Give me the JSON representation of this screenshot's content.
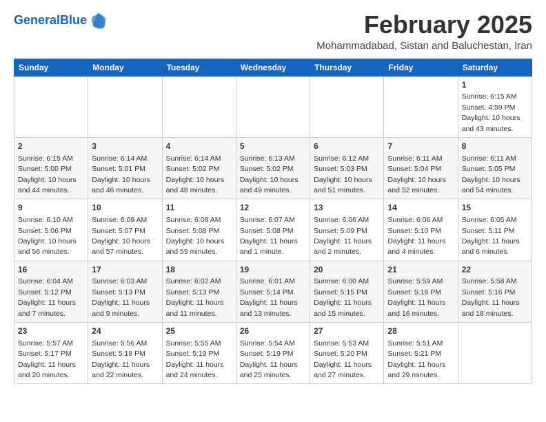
{
  "header": {
    "logo_general": "General",
    "logo_blue": "Blue",
    "title": "February 2025",
    "subtitle": "Mohammadabad, Sistan and Baluchestan, Iran"
  },
  "days_of_week": [
    "Sunday",
    "Monday",
    "Tuesday",
    "Wednesday",
    "Thursday",
    "Friday",
    "Saturday"
  ],
  "weeks": [
    [
      {
        "day": "",
        "info": ""
      },
      {
        "day": "",
        "info": ""
      },
      {
        "day": "",
        "info": ""
      },
      {
        "day": "",
        "info": ""
      },
      {
        "day": "",
        "info": ""
      },
      {
        "day": "",
        "info": ""
      },
      {
        "day": "1",
        "info": "Sunrise: 6:15 AM\nSunset: 4:59 PM\nDaylight: 10 hours and 43 minutes."
      }
    ],
    [
      {
        "day": "2",
        "info": "Sunrise: 6:15 AM\nSunset: 5:00 PM\nDaylight: 10 hours and 44 minutes."
      },
      {
        "day": "3",
        "info": "Sunrise: 6:14 AM\nSunset: 5:01 PM\nDaylight: 10 hours and 46 minutes."
      },
      {
        "day": "4",
        "info": "Sunrise: 6:14 AM\nSunset: 5:02 PM\nDaylight: 10 hours and 48 minutes."
      },
      {
        "day": "5",
        "info": "Sunrise: 6:13 AM\nSunset: 5:02 PM\nDaylight: 10 hours and 49 minutes."
      },
      {
        "day": "6",
        "info": "Sunrise: 6:12 AM\nSunset: 5:03 PM\nDaylight: 10 hours and 51 minutes."
      },
      {
        "day": "7",
        "info": "Sunrise: 6:11 AM\nSunset: 5:04 PM\nDaylight: 10 hours and 52 minutes."
      },
      {
        "day": "8",
        "info": "Sunrise: 6:11 AM\nSunset: 5:05 PM\nDaylight: 10 hours and 54 minutes."
      }
    ],
    [
      {
        "day": "9",
        "info": "Sunrise: 6:10 AM\nSunset: 5:06 PM\nDaylight: 10 hours and 56 minutes."
      },
      {
        "day": "10",
        "info": "Sunrise: 6:09 AM\nSunset: 5:07 PM\nDaylight: 10 hours and 57 minutes."
      },
      {
        "day": "11",
        "info": "Sunrise: 6:08 AM\nSunset: 5:08 PM\nDaylight: 10 hours and 59 minutes."
      },
      {
        "day": "12",
        "info": "Sunrise: 6:07 AM\nSunset: 5:08 PM\nDaylight: 11 hours and 1 minute."
      },
      {
        "day": "13",
        "info": "Sunrise: 6:06 AM\nSunset: 5:09 PM\nDaylight: 11 hours and 2 minutes."
      },
      {
        "day": "14",
        "info": "Sunrise: 6:06 AM\nSunset: 5:10 PM\nDaylight: 11 hours and 4 minutes."
      },
      {
        "day": "15",
        "info": "Sunrise: 6:05 AM\nSunset: 5:11 PM\nDaylight: 11 hours and 6 minutes."
      }
    ],
    [
      {
        "day": "16",
        "info": "Sunrise: 6:04 AM\nSunset: 5:12 PM\nDaylight: 11 hours and 7 minutes."
      },
      {
        "day": "17",
        "info": "Sunrise: 6:03 AM\nSunset: 5:13 PM\nDaylight: 11 hours and 9 minutes."
      },
      {
        "day": "18",
        "info": "Sunrise: 6:02 AM\nSunset: 5:13 PM\nDaylight: 11 hours and 11 minutes."
      },
      {
        "day": "19",
        "info": "Sunrise: 6:01 AM\nSunset: 5:14 PM\nDaylight: 11 hours and 13 minutes."
      },
      {
        "day": "20",
        "info": "Sunrise: 6:00 AM\nSunset: 5:15 PM\nDaylight: 11 hours and 15 minutes."
      },
      {
        "day": "21",
        "info": "Sunrise: 5:59 AM\nSunset: 5:16 PM\nDaylight: 11 hours and 16 minutes."
      },
      {
        "day": "22",
        "info": "Sunrise: 5:58 AM\nSunset: 5:16 PM\nDaylight: 11 hours and 18 minutes."
      }
    ],
    [
      {
        "day": "23",
        "info": "Sunrise: 5:57 AM\nSunset: 5:17 PM\nDaylight: 11 hours and 20 minutes."
      },
      {
        "day": "24",
        "info": "Sunrise: 5:56 AM\nSunset: 5:18 PM\nDaylight: 11 hours and 22 minutes."
      },
      {
        "day": "25",
        "info": "Sunrise: 5:55 AM\nSunset: 5:19 PM\nDaylight: 11 hours and 24 minutes."
      },
      {
        "day": "26",
        "info": "Sunrise: 5:54 AM\nSunset: 5:19 PM\nDaylight: 11 hours and 25 minutes."
      },
      {
        "day": "27",
        "info": "Sunrise: 5:53 AM\nSunset: 5:20 PM\nDaylight: 11 hours and 27 minutes."
      },
      {
        "day": "28",
        "info": "Sunrise: 5:51 AM\nSunset: 5:21 PM\nDaylight: 11 hours and 29 minutes."
      },
      {
        "day": "",
        "info": ""
      }
    ]
  ]
}
